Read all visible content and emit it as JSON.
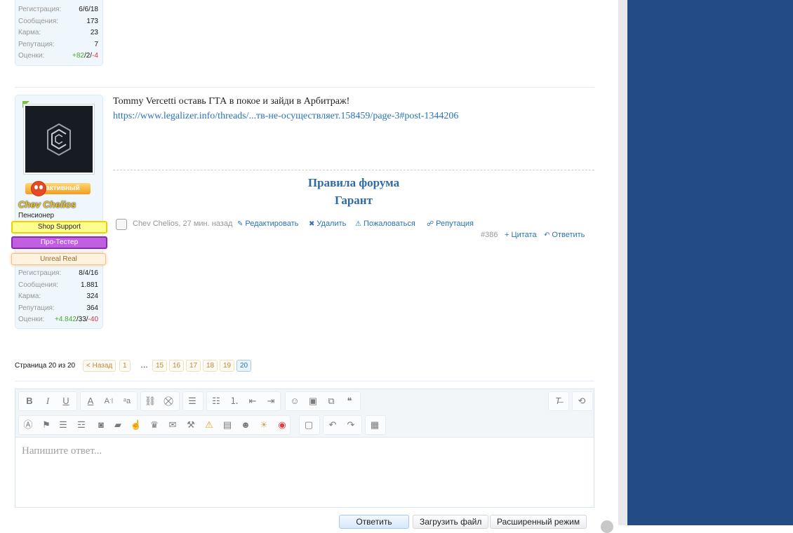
{
  "user_prev": {
    "stats": [
      {
        "key": "Регистрация:",
        "value": "6/6/18"
      },
      {
        "key": "Сообщения:",
        "value": "173"
      },
      {
        "key": "Карма:",
        "value": "23"
      },
      {
        "key": "Репутация:",
        "value": "7"
      }
    ],
    "rating_label": "Оценки:",
    "rating_pos": "+82",
    "rating_mid": "/2/",
    "rating_neg": "-4"
  },
  "user": {
    "rank_badge": "активный",
    "name": "Chev Chelios",
    "title": "Пенсионер",
    "banners": [
      "Shop Support",
      "Про-Тестер",
      "Unreal Real"
    ],
    "stats": [
      {
        "key": "Регистрация:",
        "value": "8/4/16"
      },
      {
        "key": "Сообщения:",
        "value": "1.881"
      },
      {
        "key": "Карма:",
        "value": "324"
      },
      {
        "key": "Репутация:",
        "value": "364"
      }
    ],
    "rating_label": "Оценки:",
    "rating_pos": "+4.842",
    "rating_mid": "/33/",
    "rating_neg": "-40"
  },
  "post": {
    "text": "Tommy Vercetti оставь ГТА в покое и зайди в Арбитраж!",
    "link": "https://www.legalizer.info/threads/...тв-не-осуществляет.158459/page-3#post-1344206",
    "signature_line1": "Правила форума",
    "signature_line2": "Гарант",
    "author": "Chev Chelios",
    "time": ", 27 мин. назад",
    "actions": {
      "edit": "Редактировать",
      "delete": "Удалить",
      "report": "Пожаловаться",
      "reputation": "Репутация",
      "quote": "+ Цитата",
      "reply": "Ответить"
    },
    "number": "#386"
  },
  "pagination": {
    "label": "Страница 20 из 20",
    "prev": "< Назад",
    "first": "1",
    "ellipsis": "…",
    "pages": [
      "15",
      "16",
      "17",
      "18",
      "19",
      "20"
    ]
  },
  "editor": {
    "placeholder": "Напишите ответ..."
  },
  "buttons": {
    "reply": "Ответить",
    "upload": "Загрузить файл",
    "advanced": "Расширенный режим"
  }
}
